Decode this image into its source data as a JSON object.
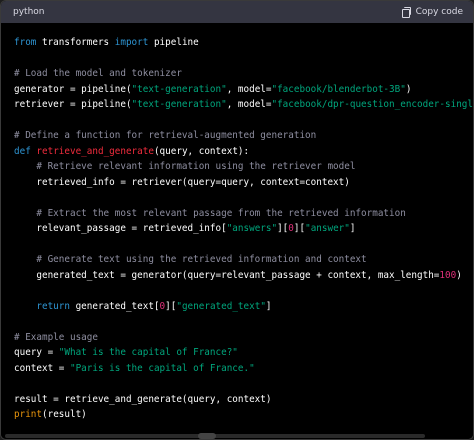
{
  "header": {
    "language": "python",
    "copy_label": "Copy code",
    "copy_icon": "clipboard-icon"
  },
  "colors": {
    "keyword": "#2e95d3",
    "string": "#00a67d",
    "number": "#df3079",
    "comment": "#8e8ea0",
    "function_name": "#f22c3d",
    "builtin": "#e9950c",
    "text": "#ffffff",
    "background": "#000000",
    "header_bg": "#343541"
  },
  "lines": [
    [
      {
        "t": "kw",
        "v": "from"
      },
      {
        "t": "",
        "v": " transformers "
      },
      {
        "t": "kw",
        "v": "import"
      },
      {
        "t": "",
        "v": " pipeline"
      }
    ],
    [],
    [
      {
        "t": "cmt",
        "v": "# Load the model and tokenizer"
      }
    ],
    [
      {
        "t": "",
        "v": "generator = pipeline("
      },
      {
        "t": "str",
        "v": "\"text-generation\""
      },
      {
        "t": "",
        "v": ", model="
      },
      {
        "t": "str",
        "v": "\"facebook/blenderbot-3B\""
      },
      {
        "t": "",
        "v": ")"
      }
    ],
    [
      {
        "t": "",
        "v": "retriever = pipeline("
      },
      {
        "t": "str",
        "v": "\"text-generation\""
      },
      {
        "t": "",
        "v": ", model="
      },
      {
        "t": "str",
        "v": "\"facebook/dpr-question_encoder-single-nq-base\""
      },
      {
        "t": "",
        "v": ")"
      }
    ],
    [],
    [
      {
        "t": "cmt",
        "v": "# Define a function for retrieval-augmented generation"
      }
    ],
    [
      {
        "t": "kw",
        "v": "def"
      },
      {
        "t": "",
        "v": " "
      },
      {
        "t": "fn",
        "v": "retrieve_and_generate"
      },
      {
        "t": "",
        "v": "(query, context):"
      }
    ],
    [
      {
        "t": "",
        "v": "    "
      },
      {
        "t": "cmt",
        "v": "# Retrieve relevant information using the retriever model"
      }
    ],
    [
      {
        "t": "",
        "v": "    retrieved_info = retriever(query=query, context=context)"
      }
    ],
    [],
    [
      {
        "t": "",
        "v": "    "
      },
      {
        "t": "cmt",
        "v": "# Extract the most relevant passage from the retrieved information"
      }
    ],
    [
      {
        "t": "",
        "v": "    relevant_passage = retrieved_info["
      },
      {
        "t": "str",
        "v": "\"answers\""
      },
      {
        "t": "",
        "v": "]["
      },
      {
        "t": "num",
        "v": "0"
      },
      {
        "t": "",
        "v": "]["
      },
      {
        "t": "str",
        "v": "\"answer\""
      },
      {
        "t": "",
        "v": "]"
      }
    ],
    [],
    [
      {
        "t": "",
        "v": "    "
      },
      {
        "t": "cmt",
        "v": "# Generate text using the retrieved information and context"
      }
    ],
    [
      {
        "t": "",
        "v": "    generated_text = generator(query=relevant_passage + context, max_length="
      },
      {
        "t": "num",
        "v": "100"
      },
      {
        "t": "",
        "v": ")"
      }
    ],
    [],
    [
      {
        "t": "",
        "v": "    "
      },
      {
        "t": "kw",
        "v": "return"
      },
      {
        "t": "",
        "v": " generated_text["
      },
      {
        "t": "num",
        "v": "0"
      },
      {
        "t": "",
        "v": "]["
      },
      {
        "t": "str",
        "v": "\"generated_text\""
      },
      {
        "t": "",
        "v": "]"
      }
    ],
    [],
    [
      {
        "t": "cmt",
        "v": "# Example usage"
      }
    ],
    [
      {
        "t": "",
        "v": "query = "
      },
      {
        "t": "str",
        "v": "\"What is the capital of France?\""
      }
    ],
    [
      {
        "t": "",
        "v": "context = "
      },
      {
        "t": "str",
        "v": "\"Paris is the capital of France.\""
      }
    ],
    [],
    [
      {
        "t": "",
        "v": "result = retrieve_and_generate(query, context)"
      }
    ],
    [
      {
        "t": "bi",
        "v": "print"
      },
      {
        "t": "",
        "v": "(result)"
      }
    ]
  ]
}
